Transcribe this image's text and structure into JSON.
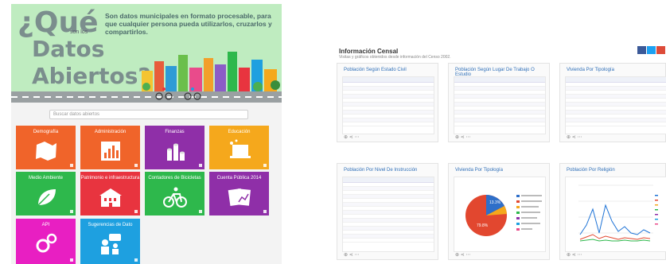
{
  "hero": {
    "question_mark_que": "¿Qué",
    "son_los": "son los",
    "datos": "Datos",
    "abiertos": "Abiertos?",
    "description": "Son datos municipales en formato procesable, para que cualquier persona pueda utilizarlos, cruzarlos y compartirlos."
  },
  "search": {
    "placeholder": "Buscar datos abiertos"
  },
  "tiles": [
    {
      "label": "Demografía",
      "color": "#f0642a",
      "icon": "map-icon"
    },
    {
      "label": "Administración",
      "color": "#f0642a",
      "icon": "bar-chart-icon"
    },
    {
      "label": "Finanzas",
      "color": "#8f2fa8",
      "icon": "coins-icon"
    },
    {
      "label": "Educación",
      "color": "#f5a81c",
      "icon": "laptop-icon"
    },
    {
      "label": "Medio Ambiente",
      "color": "#2eb84c",
      "icon": "leaf-icon"
    },
    {
      "label": "Patrimonio e infraestructura",
      "color": "#e8343f",
      "icon": "building-icon"
    },
    {
      "label": "Contadores de Bicicletas",
      "color": "#2eb84c",
      "icon": "bicycle-icon"
    },
    {
      "label": "Cuenta Pública 2014",
      "color": "#8f2fa8",
      "icon": "chart-papers-icon"
    },
    {
      "label": "API",
      "color": "#e81fc2",
      "icon": "gears-icon"
    },
    {
      "label": "Sugerencias de Dato",
      "color": "#1ea0e0",
      "icon": "people-icon"
    }
  ],
  "census": {
    "title": "Información Censal",
    "subtitle": "Visitas y gráficos obtenidos desde información del Censo 2002.",
    "cards": [
      {
        "title": "Población Según Estado Civil"
      },
      {
        "title": "Población Según Lugar De Trabajo O Estudio"
      },
      {
        "title": "Vivienda Por Tipología"
      },
      {
        "title": "Población Por Nivel De Instrucción"
      },
      {
        "title": "Vivienda Por Tipología"
      },
      {
        "title": "Población Por Religión"
      }
    ],
    "pie_labels": [
      "13.3%",
      "79.8%"
    ]
  }
}
